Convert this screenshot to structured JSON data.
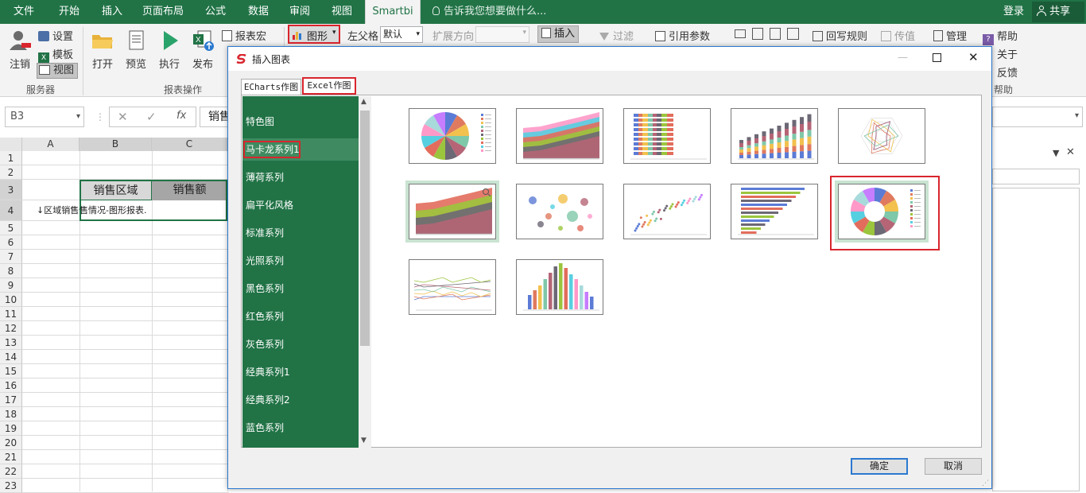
{
  "menubar": {
    "tabs": [
      "文件",
      "开始",
      "插入",
      "页面布局",
      "公式",
      "数据",
      "审阅",
      "视图",
      "Smartbi"
    ],
    "active": "Smartbi",
    "tell_me": "告诉我您想要做什么...",
    "login": "登录",
    "share": "共享"
  },
  "ribbon": {
    "logout": "注销",
    "settings": "设置",
    "template": "模板",
    "view": "视图",
    "group_server": "服务器",
    "open": "打开",
    "preview": "预览",
    "execute": "执行",
    "publish": "发布",
    "group_report_ops": "报表操作",
    "report_macro": "报表宏",
    "chart": "图形",
    "left_parent": "左父格",
    "left_parent_value": "默认",
    "expand_dir": "扩展方向",
    "insert": "插入",
    "filter": "过滤",
    "ref_param": "引用参数",
    "writeback_rules": "回写规则",
    "pass_value": "传值",
    "manage": "管理",
    "help": "帮助",
    "about": "关于",
    "feedback": "反馈",
    "group_help": "帮助"
  },
  "formula": {
    "namebox": "B3",
    "fx": "fx",
    "content": "销售"
  },
  "sheet": {
    "columns": [
      "A",
      "B",
      "C"
    ],
    "rows": [
      "1",
      "2",
      "3",
      "4",
      "5",
      "6",
      "7",
      "8",
      "9",
      "10",
      "11",
      "12",
      "13",
      "14",
      "15",
      "16",
      "17",
      "18",
      "19",
      "20",
      "21",
      "22",
      "23"
    ],
    "b3": "销售区域",
    "c3": "销售额",
    "a4": "↓区域销售情况-图形报表",
    "b4": "售情况-图形报表.",
    "c4": ""
  },
  "dialog": {
    "title": "插入图表",
    "tabs": [
      "ECharts作图",
      "Excel作图"
    ],
    "active_tab": "Excel作图",
    "categories": [
      "特色图",
      "马卡龙系列1",
      "薄荷系列",
      "扁平化风格",
      "标准系列",
      "光照系列",
      "黑色系列",
      "红色系列",
      "灰色系列",
      "经典系列1",
      "经典系列2",
      "蓝色系列"
    ],
    "selected_category": "马卡龙系列1",
    "thumbnails": [
      "pie",
      "stacked-area",
      "stacked-bar-h",
      "stacked-column",
      "radar",
      "area-selected",
      "bubble",
      "scatter",
      "bar-horizontal",
      "donut",
      "line",
      "column"
    ],
    "selected_thumbnail": "donut",
    "ok": "确定",
    "cancel": "取消"
  },
  "colors": {
    "excel_green": "#217346",
    "accent_red": "#d9252d",
    "panel_green": "#217346"
  }
}
